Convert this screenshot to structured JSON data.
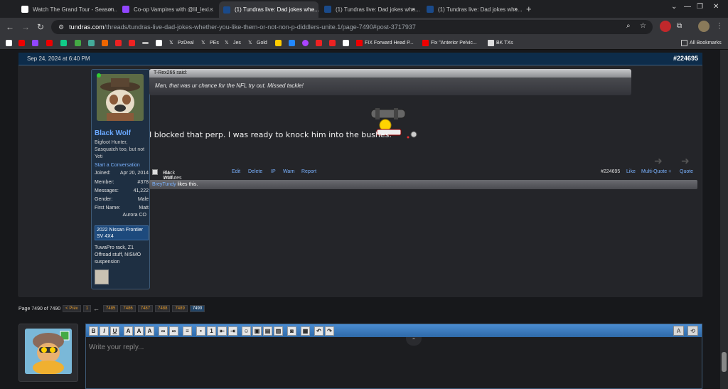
{
  "tabs": [
    {
      "title": "Watch The Grand Tour - Season...",
      "color": "#1a1a1a",
      "active": false
    },
    {
      "title": "Co-op Vampires with @lil_lexi...",
      "color": "#9146ff",
      "active": false
    },
    {
      "title": "(1) Tundras live: Dad jokes whe...",
      "color": "#1a4a8a",
      "active": true
    },
    {
      "title": "(1) Tundras live: Dad jokes whe...",
      "color": "#1a4a8a",
      "active": false
    },
    {
      "title": "(1) Tundras live: Dad jokes whe...",
      "color": "#1a4a8a",
      "active": false
    }
  ],
  "tab_close_glyph": "×",
  "new_tab_glyph": "+",
  "window_controls": [
    "⌄",
    "—",
    "❐",
    "✕"
  ],
  "nav": {
    "back": "←",
    "forward": "→",
    "reload": "↻"
  },
  "address": {
    "domain": "tundras.com",
    "path": "/threads/tundras-live-dad-jokes-whether-you-like-them-or-not-non-p-diddlers-unite.1/page-7490#post-3717937"
  },
  "bookmarks": [
    {
      "label": "PzDeal",
      "color": "#ffffff"
    },
    {
      "label": "PEs",
      "color": "#ffffff"
    },
    {
      "label": "Jes",
      "color": "#ffffff"
    },
    {
      "label": "Gold",
      "color": "#ffffff"
    },
    {
      "label": "FIX Forward Head P...",
      "color": "#ff0000"
    },
    {
      "label": "Fix \"Anterior Pelvic...",
      "color": "#ff0000"
    },
    {
      "label": "BK TXs",
      "color": "#d9d9d9"
    }
  ],
  "all_bookmarks": "All Bookmarks",
  "post": {
    "date": "Sep 24, 2024 at 6:40 PM",
    "number": "#224695",
    "author": "Black Wolf",
    "user_title": "Bigfoot Hunter, Sasquatch too, but not Yeti",
    "start_conversation": "Start a Conversation",
    "stats": [
      {
        "label": "Joined:",
        "value": "Apr 20, 2014"
      },
      {
        "label": "Member:",
        "value": "#378"
      },
      {
        "label": "Messages:",
        "value": "41,222"
      },
      {
        "label": "Gender:",
        "value": "Male"
      },
      {
        "label": "First Name:",
        "value": "Matt"
      }
    ],
    "location": "Aurora CO",
    "truck": "2022 Nissan Frontier SV 4X4",
    "mods": "TuwaPro rack, Z1 Offroad stuff, NISMO suspension",
    "quote_author": "T-Rex266 said:",
    "quote_text": "Man, that was ur chance for the NFL try out. Missed tackle!",
    "message": "I blocked that perp. I was ready to knock him into the bushes.",
    "footer": {
      "author": "Black Wolf",
      "time": "14 minutes ago",
      "actions": [
        "Edit",
        "Delete",
        "IP",
        "Warn",
        "Report"
      ],
      "post_number": "#224695",
      "like": "Like",
      "multiquote": "Multi-Quote +",
      "quote": "Quote"
    },
    "likes_user": "BreyTundy",
    "likes_suffix": " likes this."
  },
  "pagination": {
    "label": "Page 7490 of 7490",
    "prev": "< Prev",
    "first": "1",
    "ellipsis_arrow": "←",
    "pages": [
      "7485",
      "7486",
      "7487",
      "7488",
      "7489",
      "7490"
    ]
  },
  "reply": {
    "placeholder": "Write your reply...",
    "collapse_glyph": "⌃"
  },
  "editor_buttons": [
    "B",
    "I",
    "U",
    "A",
    "A",
    "A",
    "∞",
    "∞",
    "≡",
    "•",
    "1",
    "⇤",
    "⇥",
    "☺",
    "▣",
    "▤",
    "▥",
    "◙",
    "▦",
    "↶",
    "↷"
  ],
  "editor_right_buttons": [
    "A",
    "⟲"
  ]
}
